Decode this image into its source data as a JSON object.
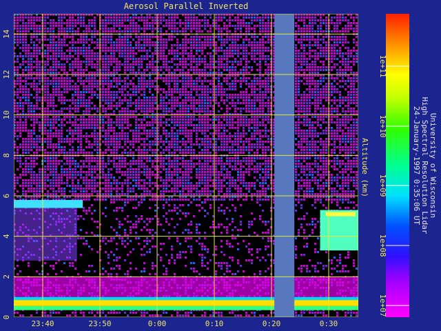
{
  "chart_data": {
    "type": "heatmap",
    "title": "Aerosol Parallel Inverted",
    "ylabel": "Altitude (km)",
    "xlabel": "",
    "x_ticks": [
      "23:40",
      "23:50",
      "0:00",
      "0:10",
      "0:20",
      "0:30"
    ],
    "y_ticks": [
      0,
      2,
      4,
      6,
      8,
      10,
      12,
      14
    ],
    "ylim": [
      0,
      15
    ],
    "grid": true,
    "colorbar": {
      "scale": "log",
      "ticks": [
        "1e+07",
        "1e+08",
        "1e+09",
        "1e+10",
        "1e+11"
      ],
      "range": [
        "1e+07",
        "1e+12"
      ]
    },
    "features": [
      {
        "name": "boundary layer",
        "altitude_km": [
          0.5,
          1.0
        ],
        "intensity": "1e+09 - 1e+11"
      },
      {
        "name": "aerosol layer",
        "altitude_km": [
          1.0,
          2.0
        ],
        "intensity": "1e+07"
      },
      {
        "name": "cloud layer (early)",
        "altitude_km": [
          4.5,
          5.8
        ],
        "time": [
          "23:34",
          "23:47"
        ]
      },
      {
        "name": "cloud layer (late)",
        "altitude_km": [
          3.2,
          5.3
        ],
        "time": [
          "0:28",
          "0:35"
        ]
      },
      {
        "name": "data gap",
        "time": [
          "0:21",
          "0:23"
        ]
      }
    ]
  },
  "side_text": {
    "line1": "University of Wisconsin",
    "line2": "High Spectral Resolution Lidar",
    "line3": "24-January-1997 0:35:06 UT"
  },
  "colors": {
    "background": "#1c2490",
    "axis_text": "#f0e860",
    "grid": "#e8e830",
    "noise_a": "#c800d8",
    "noise_b": "#6a28e0",
    "gap": "#5878c0"
  }
}
